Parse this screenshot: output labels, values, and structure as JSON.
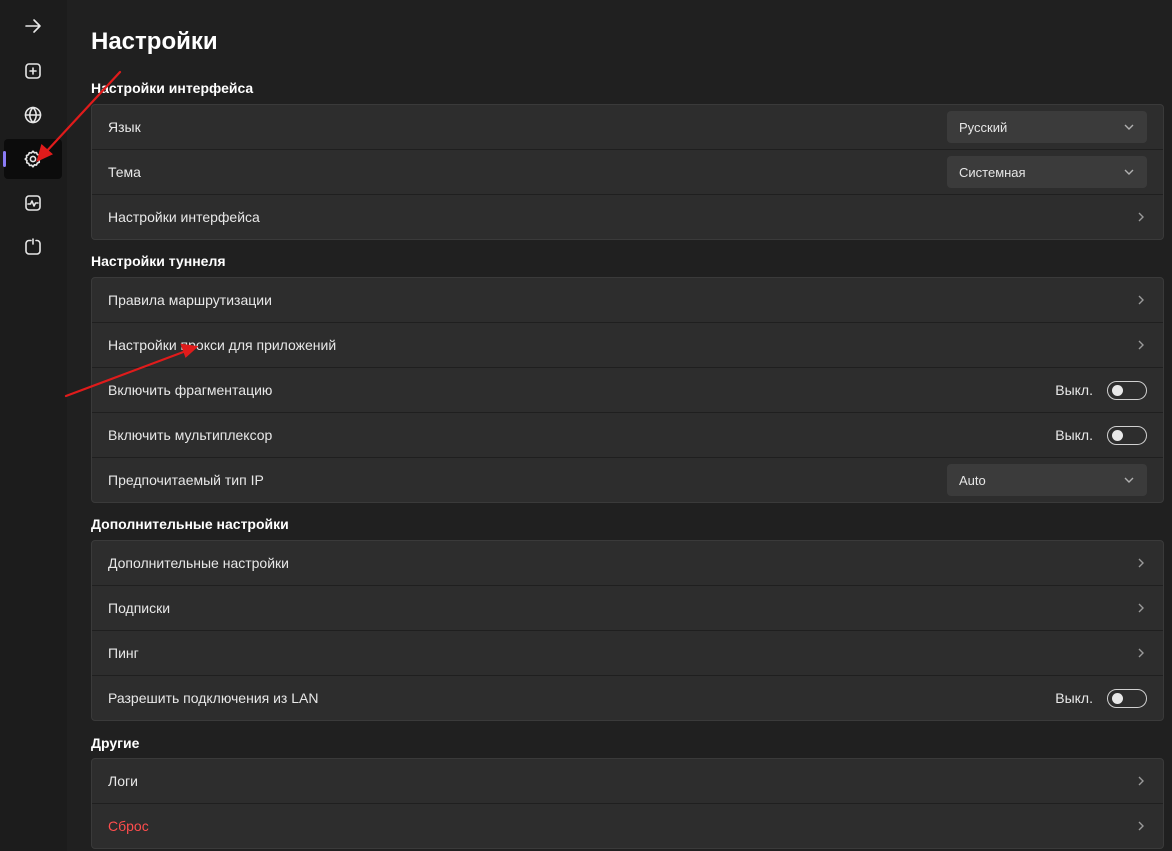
{
  "page": {
    "title": "Настройки"
  },
  "sidebar": {
    "items": [
      {
        "icon": "arrow-right-icon"
      },
      {
        "icon": "plus-square-icon"
      },
      {
        "icon": "globe-icon"
      },
      {
        "icon": "gear-icon",
        "active": true
      },
      {
        "icon": "activity-monitor-icon"
      },
      {
        "icon": "power-restart-icon"
      }
    ],
    "accent_color": "#8b7cf6"
  },
  "sections": {
    "interface": {
      "title": "Настройки интерфейса",
      "language": {
        "label": "Язык",
        "value": "Русский"
      },
      "theme": {
        "label": "Тема",
        "value": "Системная"
      },
      "interface_settings": {
        "label": "Настройки интерфейса"
      }
    },
    "tunnel": {
      "title": "Настройки туннеля",
      "routing_rules": {
        "label": "Правила маршрутизации"
      },
      "app_proxy": {
        "label": "Настройки прокси для приложений"
      },
      "fragmentation": {
        "label": "Включить фрагментацию",
        "state": "Выкл."
      },
      "multiplexer": {
        "label": "Включить мультиплексор",
        "state": "Выкл."
      },
      "ip_type": {
        "label": "Предпочитаемый тип IP",
        "value": "Auto"
      }
    },
    "advanced": {
      "title": "Дополнительные настройки",
      "advanced_settings": {
        "label": "Дополнительные настройки"
      },
      "subscriptions": {
        "label": "Подписки"
      },
      "ping": {
        "label": "Пинг"
      },
      "lan": {
        "label": "Разрешить подключения из LAN",
        "state": "Выкл."
      }
    },
    "other": {
      "title": "Другие",
      "logs": {
        "label": "Логи"
      },
      "reset": {
        "label": "Сброс"
      }
    }
  },
  "colors": {
    "background": "#202020",
    "card": "#2d2d2d",
    "danger": "#ff4d4d",
    "annotation_arrow": "#e01b1b"
  }
}
